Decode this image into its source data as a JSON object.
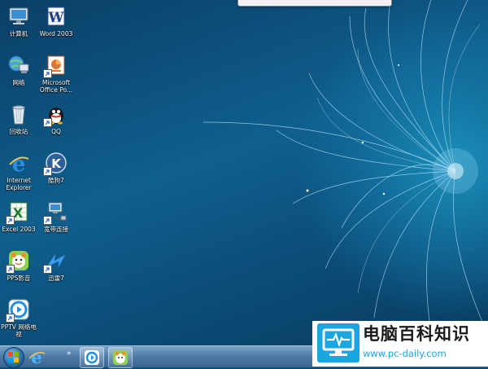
{
  "desktop_icons": [
    {
      "label": "计算机",
      "icon": "computer-icon"
    },
    {
      "label": "Word 2003",
      "icon": "word-icon"
    },
    {
      "label": "网络",
      "icon": "network-icon"
    },
    {
      "label": "Microsoft\nOffice Po...",
      "icon": "powerpoint-icon"
    },
    {
      "label": "回收站",
      "icon": "recycle-bin-icon"
    },
    {
      "label": "QQ",
      "icon": "qq-icon"
    },
    {
      "label": "Internet\nExplorer",
      "icon": "internet-explorer-icon"
    },
    {
      "label": "酷狗7",
      "icon": "kugou-icon"
    },
    {
      "label": "Excel 2003",
      "icon": "excel-icon"
    },
    {
      "label": "宽带连接",
      "icon": "broadband-icon"
    },
    {
      "label": "PPS影音",
      "icon": "pps-icon"
    },
    {
      "label": "迅雷7",
      "icon": "thunder-icon"
    },
    {
      "label": "PPTV 网络电\n视",
      "icon": "pptv-icon"
    }
  ],
  "taskbar": {
    "start_icon": "windows-logo-icon",
    "quick_launch": [
      "internet-explorer-icon"
    ],
    "overflow_glyph": "»",
    "buttons": [
      "pptv-icon",
      "pps-icon"
    ]
  },
  "watermark": {
    "title": "电脑百科知识",
    "url": "www.pc-daily.com",
    "logo_icon": "monitor-heartbeat-icon",
    "color": "#1aa6e0"
  },
  "colors": {
    "desktop_base": "#0b4f7a",
    "glow": "#1a8fb8",
    "taskbar": "#4c7aa5"
  }
}
